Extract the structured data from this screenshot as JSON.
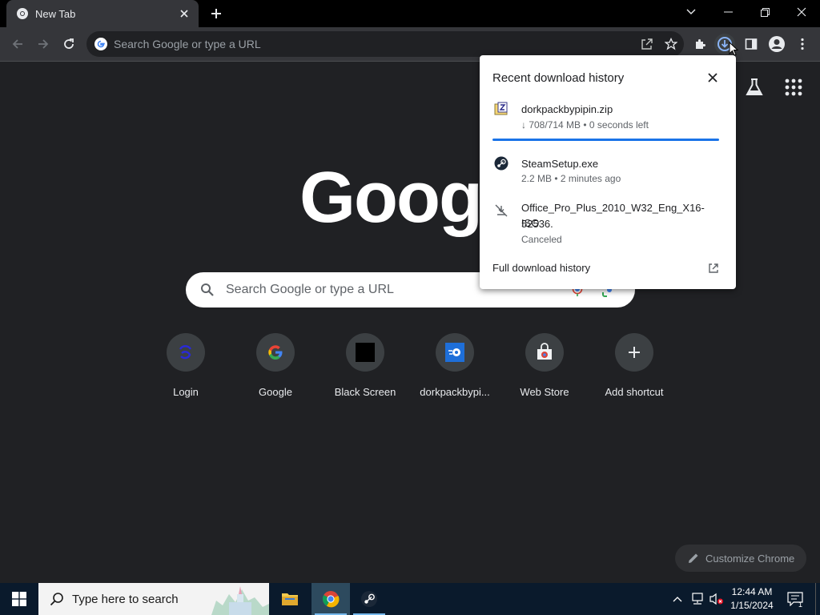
{
  "browser": {
    "tab": {
      "title": "New Tab"
    },
    "omnibox": {
      "placeholder": "Search Google or type a URL"
    }
  },
  "ntp": {
    "logo": "Googl",
    "search_placeholder": "Search Google or type a URL",
    "shortcuts": [
      {
        "label": "Login",
        "icon": "login-site-icon"
      },
      {
        "label": "Google",
        "icon": "google-g-icon"
      },
      {
        "label": "Black Screen",
        "icon": "black-square-icon"
      },
      {
        "label": "dorkpackbypi...",
        "icon": "dorkpack-site-icon"
      },
      {
        "label": "Web Store",
        "icon": "web-store-icon"
      },
      {
        "label": "Add shortcut",
        "icon": "plus-icon"
      }
    ],
    "customize_label": "Customize Chrome"
  },
  "downloads": {
    "title": "Recent download history",
    "items": [
      {
        "name": "dorkpackbypipin.zip",
        "status": "↓ 708/714 MB • 0 seconds left",
        "progress": 0.99,
        "icon": "zip-file-icon"
      },
      {
        "name": "SteamSetup.exe",
        "status": "2.2 MB • 2 minutes ago",
        "icon": "steam-icon"
      },
      {
        "name": "Office_Pro_Plus_2010_W32_Eng_X16-52536.",
        "name2": "ISO",
        "status": "Canceled",
        "icon": "download-off-icon"
      }
    ],
    "full_history": "Full download history"
  },
  "taskbar": {
    "search_placeholder": "Type here to search",
    "time": "12:44 AM",
    "date": "1/15/2024",
    "notification_count": "1"
  },
  "colors": {
    "accent": "#1a73e8",
    "background": "#202124",
    "toolbar": "#35363a"
  }
}
